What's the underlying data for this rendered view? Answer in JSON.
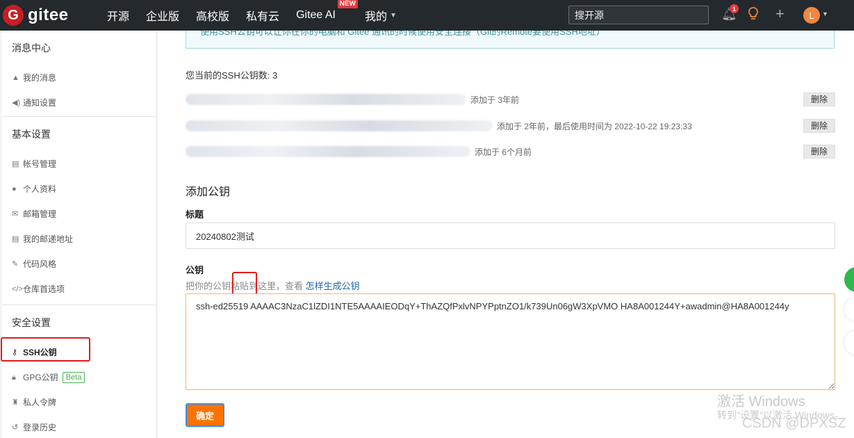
{
  "nav": {
    "logo_text": "gitee",
    "items": [
      "开源",
      "企业版",
      "高校版",
      "私有云",
      "Gitee AI",
      "我的"
    ],
    "new_badge": "NEW",
    "search_placeholder": "搜开源",
    "notification_count": "1",
    "avatar_letter": "L"
  },
  "sidebar": {
    "sections": [
      {
        "title": "消息中心",
        "items": [
          {
            "label": "我的消息",
            "icon": "bell-icon"
          },
          {
            "label": "通知设置",
            "icon": "speaker-icon"
          }
        ]
      },
      {
        "title": "基本设置",
        "items": [
          {
            "label": "帐号管理",
            "icon": "id-card-icon"
          },
          {
            "label": "个人资料",
            "icon": "user-icon"
          },
          {
            "label": "邮箱管理",
            "icon": "mail-icon"
          },
          {
            "label": "我的邮递地址",
            "icon": "address-card-icon"
          },
          {
            "label": "代码风格",
            "icon": "brush-icon"
          },
          {
            "label": "仓库首选项",
            "icon": "code-icon"
          }
        ]
      },
      {
        "title": "安全设置",
        "items": [
          {
            "label": "SSH公钥",
            "icon": "key-icon",
            "active": true
          },
          {
            "label": "GPG公钥",
            "icon": "lock-icon",
            "badge": "Beta"
          },
          {
            "label": "私人令牌",
            "icon": "token-icon"
          },
          {
            "label": "登录历史",
            "icon": "history-icon"
          }
        ]
      }
    ]
  },
  "main": {
    "banner": "使用SSH公钥可以让你在你的电脑和 Gitee 通讯的时候使用安全连接（Git的Remote要使用SSH地址）",
    "key_count_text": "您当前的SSH公钥数: 3",
    "keys": [
      {
        "meta": "添加于 3年前",
        "delete_label": "删除"
      },
      {
        "meta": "添加于 2年前，最后使用时间为 2022-10-22 19:23:33",
        "delete_label": "删除"
      },
      {
        "meta": "添加于 6个月前",
        "delete_label": "删除"
      }
    ],
    "add_title": "添加公钥",
    "title_label": "标题",
    "title_value": "20240802测试",
    "key_label": "公钥",
    "help_prefix": "把你的公钥粘贴到这里，查看 ",
    "help_link": "怎样生成公钥",
    "key_value": "ssh-ed25519 AAAAC3NzaC1lZDI1NTE5AAAAIEODqY+ThAZQfPxlvNPYPptnZO1/k739Un06gW3XpVMO HA8A001244Y+awadmin@HA8A001244y",
    "confirm_label": "确定"
  },
  "overlay": {
    "watermark_line1": "激活 Windows",
    "watermark_line2": "转到\"设置\"以激活 Windows。",
    "csdn": "CSDN @DPXSZ"
  },
  "colors": {
    "nav_bg": "#24292e",
    "brand_red": "#c71d23",
    "confirm_orange": "#fe7300",
    "link_blue": "#1966b6"
  }
}
